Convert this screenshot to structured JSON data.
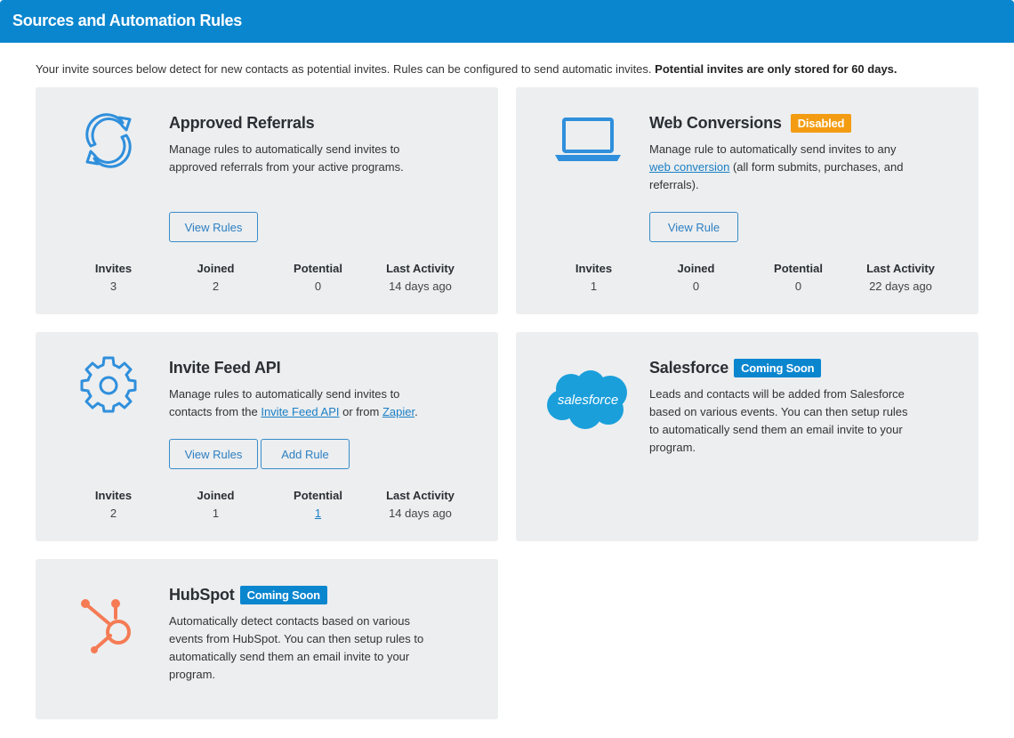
{
  "header": {
    "title": "Sources and Automation Rules"
  },
  "intro": {
    "text": "Your invite sources below detect for new contacts as potential invites. Rules can be configured to send automatic invites.",
    "bold": "Potential invites are only stored for 60 days."
  },
  "stat_labels": {
    "invites": "Invites",
    "joined": "Joined",
    "potential": "Potential",
    "last_activity": "Last Activity"
  },
  "colors": {
    "header": "#0a86cf",
    "card_bg": "#eceef0",
    "accent_blue": "#0a86cf",
    "disabled_orange": "#f39c12",
    "hubspot_orange": "#f57b54",
    "salesforce_blue": "#1a9fdb"
  },
  "cards": {
    "approved_referrals": {
      "icon": "refresh-icon",
      "title": "Approved Referrals",
      "desc": "Manage rules to automatically send invites to approved referrals from your active programs.",
      "button": "View Rules",
      "stats": {
        "invites": "3",
        "joined": "2",
        "potential": "0",
        "last_activity": "14 days ago"
      }
    },
    "web_conversions": {
      "icon": "laptop-icon",
      "title": "Web Conversions",
      "badge": "Disabled",
      "desc_pre": "Manage rule to automatically send invites to any",
      "desc_link": "web conversion",
      "desc_post": "(all form submits, purchases, and referrals).",
      "button": "View Rule",
      "stats": {
        "invites": "1",
        "joined": "0",
        "potential": "0",
        "last_activity": "22 days ago"
      }
    },
    "invite_feed_api": {
      "icon": "gear-icon",
      "title": "Invite Feed API",
      "desc_pre": "Manage rules to automatically send invites to contacts from the",
      "desc_link1": "Invite Feed API",
      "desc_mid": "or from",
      "desc_link2": "Zapier",
      "desc_post": ".",
      "button1": "View Rules",
      "button2": "Add Rule",
      "stats": {
        "invites": "2",
        "joined": "1",
        "potential": "1",
        "last_activity": "14 days ago"
      }
    },
    "salesforce": {
      "icon": "salesforce-logo",
      "logo_text": "salesforce",
      "title": "Salesforce",
      "badge": "Coming Soon",
      "desc": "Leads and contacts will be added from Salesforce based on various events. You can then setup rules to automatically send them an email invite to your program."
    },
    "hubspot": {
      "icon": "hubspot-logo",
      "title": "HubSpot",
      "badge": "Coming Soon",
      "desc": "Automatically detect contacts based on various events from HubSpot. You can then setup rules to automatically send them an email invite to your program."
    }
  }
}
